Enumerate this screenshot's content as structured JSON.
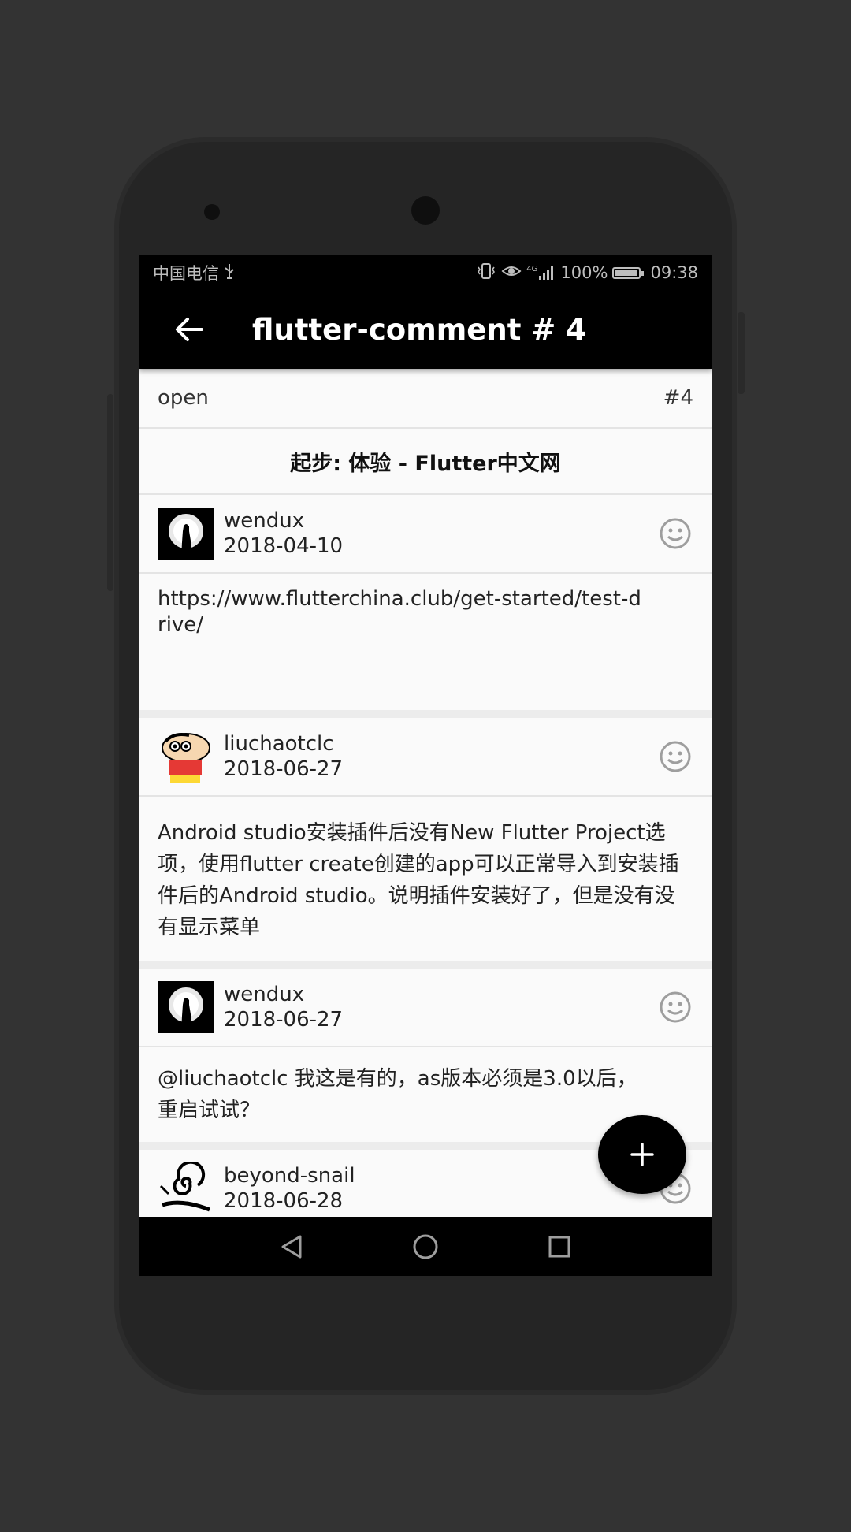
{
  "status_bar": {
    "carrier": "中国电信",
    "usb_icon": "usb-icon",
    "network_label": "4G",
    "battery_percent": "100%",
    "time": "09:38"
  },
  "app_bar": {
    "title": "flutter-comment # 4",
    "back_icon": "arrow-left-icon"
  },
  "issue": {
    "state": "open",
    "number": "#4",
    "title": "起步: 体验 - Flutter中文网"
  },
  "comments": [
    {
      "user": "wendux",
      "date": "2018-04-10",
      "avatar": "moon-silhouette-avatar",
      "body": "https://www.flutterchina.club/get-started/test-drive/"
    },
    {
      "user": "liuchaotclc",
      "date": "2018-06-27",
      "avatar": "cartoon-boy-avatar",
      "body": "Android studio安装插件后没有New Flutter Project选项，使用flutter create创建的app可以正常导入到安装插件后的Android studio。说明插件安装好了，但是没有没有显示菜单"
    },
    {
      "user": "wendux",
      "date": "2018-06-27",
      "avatar": "moon-silhouette-avatar",
      "body": "@liuchaotclc  我这是有的，as版本必须是3.0以后，重启试试？"
    },
    {
      "user": "beyond-snail",
      "date": "2018-06-28",
      "avatar": "snail-sketch-avatar",
      "body": ""
    }
  ],
  "fab": {
    "label": "+",
    "icon": "add-icon"
  },
  "nav_bar": {
    "back": "nav-back-icon",
    "home": "nav-home-icon",
    "recents": "nav-recents-icon"
  },
  "colors": {
    "bar": "#000000",
    "background": "#fafafa",
    "divider": "#e4e4e4",
    "icon_gray": "#9e9e9e"
  }
}
